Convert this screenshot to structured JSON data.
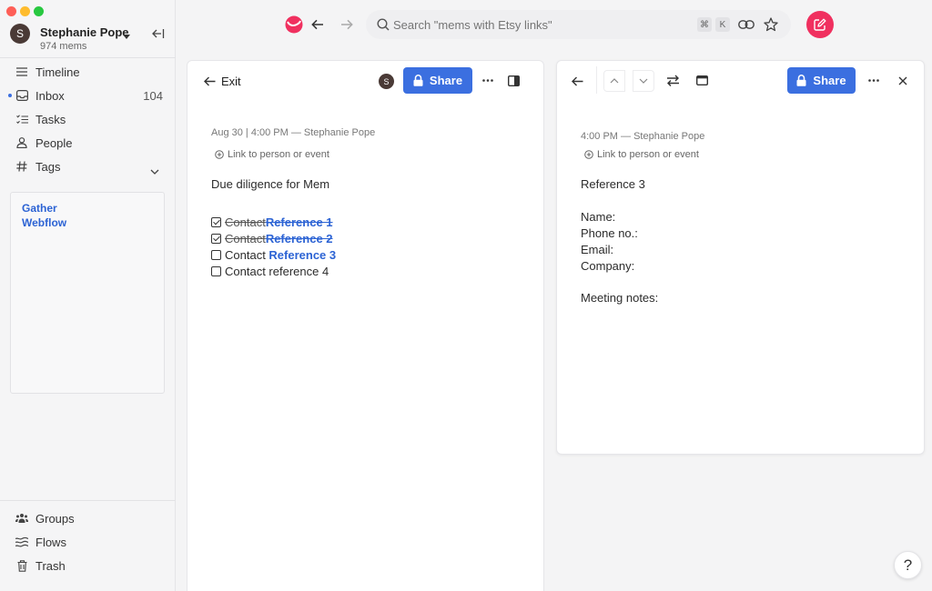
{
  "window": {
    "colors": {
      "close": "#fe5f57",
      "minimize": "#febc2e",
      "zoom": "#28c840"
    }
  },
  "account": {
    "initial": "S",
    "name": "Stephanie Pope",
    "mem_count": "974 mems"
  },
  "sidebar": {
    "items": [
      {
        "label": "Timeline",
        "icon": "list-icon"
      },
      {
        "label": "Inbox",
        "icon": "inbox-icon",
        "count": "104",
        "unread": true
      },
      {
        "label": "Tasks",
        "icon": "tasks-icon"
      },
      {
        "label": "People",
        "icon": "person-icon"
      },
      {
        "label": "Tags",
        "icon": "hash-icon"
      }
    ],
    "pinned": [
      "Gather",
      "Webflow"
    ],
    "bottom_items": [
      {
        "label": "Groups",
        "icon": "groups-icon"
      },
      {
        "label": "Flows",
        "icon": "flows-icon"
      },
      {
        "label": "Trash",
        "icon": "trash-icon"
      }
    ]
  },
  "topbar": {
    "search_placeholder": "Search \"mems with Etsy links\"",
    "shortcut_cmd": "⌘",
    "shortcut_key": "K"
  },
  "left_pane": {
    "exit_label": "Exit",
    "owner_initial": "S",
    "share_label": "Share",
    "meta": "Aug 30 | 4:00 PM — Stephanie Pope",
    "link_label": "Link to person or event",
    "title": "Due diligence for Mem",
    "tasks": [
      {
        "prefix": "Contact ",
        "link": "Reference 1",
        "done": true
      },
      {
        "prefix": "Contact ",
        "link": "Reference 2",
        "done": true
      },
      {
        "prefix": "Contact ",
        "link": "Reference 3",
        "done": false
      },
      {
        "prefix": "Contact reference 4",
        "link": "",
        "done": false
      }
    ]
  },
  "right_pane": {
    "share_label": "Share",
    "meta": "4:00 PM — Stephanie Pope",
    "link_label": "Link to person or event",
    "title": "Reference 3",
    "fields": [
      "Name:",
      "Phone no.:",
      "Email:",
      "Company:"
    ],
    "notes_label": "Meeting notes:"
  },
  "help_label": "?",
  "colors": {
    "accent": "#3b6fe0",
    "brand": "#f0305f",
    "link": "#2c63d4"
  }
}
